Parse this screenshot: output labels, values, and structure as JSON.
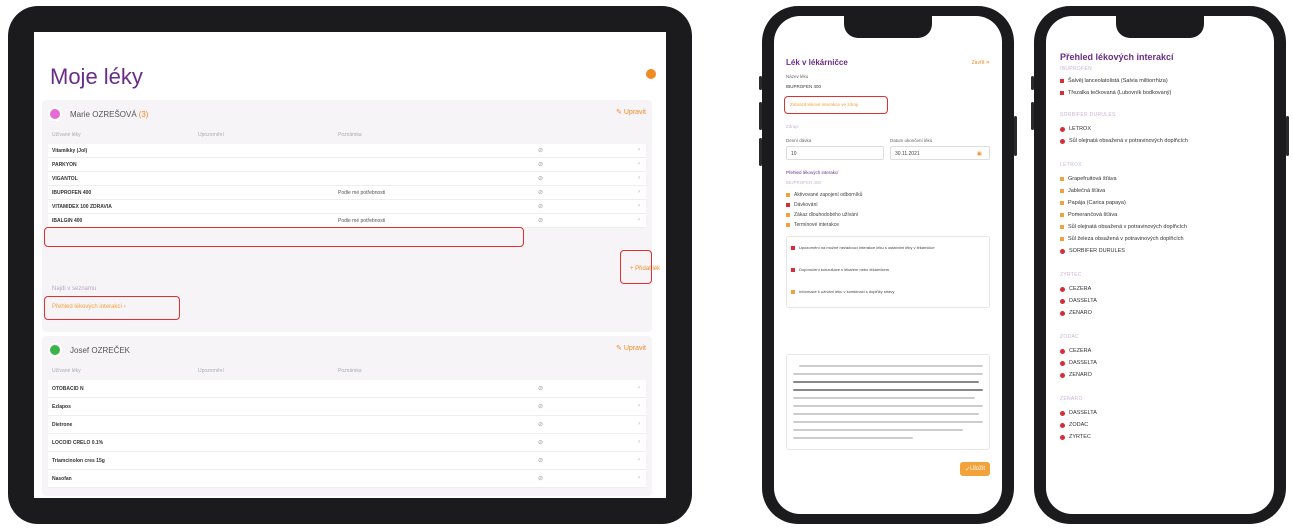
{
  "colors": {
    "purple": "#6a2d86",
    "orange": "#f08a24",
    "red": "#e03030",
    "yellow": "#f2a23a",
    "red_marker": "#d62d3a"
  },
  "tablet": {
    "title": "Moje léky",
    "patient1": {
      "name": "Marie OZREŠOVÁ",
      "tag": "(3)",
      "edit": "Upravit",
      "col_headers": [
        "Užívané léky",
        "Upozornění",
        "Poznámka"
      ],
      "drugs": [
        {
          "name": "Vitamikky (Jol)",
          "note": ""
        },
        {
          "name": "PARKYON",
          "note": ""
        },
        {
          "name": "VIGANTOL",
          "note": ""
        },
        {
          "name": "IBUPROFEN 400",
          "note": "Podle mé potřebnosti"
        },
        {
          "name": "VITAMIDEX 100 ZDRAVIA",
          "note": ""
        },
        {
          "name": "IBALGIN 400",
          "note": "Podle mé potřebnosti"
        }
      ],
      "add": "Přidat lék",
      "link1": "Najdi v seznamu",
      "link2": "Přehled lékových interakcí ›"
    },
    "patient2": {
      "name": "Josef OZREČEK",
      "edit": "Upravit",
      "col_headers": [
        "Užívané léky",
        "Upozornění",
        "Poznámka"
      ],
      "drugs": [
        {
          "name": "OTOBACID N"
        },
        {
          "name": "Ezlapos"
        },
        {
          "name": "Dietrone"
        },
        {
          "name": "LOCOID CRELO 0.1%"
        },
        {
          "name": "Triamcinolon cres 15g"
        },
        {
          "name": "Nasofan"
        }
      ]
    }
  },
  "phone1": {
    "title": "Lék v lékárničce",
    "close": "Zavřít",
    "drug_label": "Název léku",
    "drug_value": "IBUPROFEN 400",
    "interaction_link": "Zobrazit lékové interakce ve zdroji",
    "section": "Zdroje",
    "dose_label": "Denní dávka",
    "date_label": "Datum ukončení léku",
    "dose_value": "10",
    "date_value": "30.11.2021",
    "overview": "Přehled lékových interakcí",
    "sub": "IBUPROFEN 400",
    "items": [
      "Aktivované zapojení odborníků",
      "Dávkování",
      "Zákaz dlouhodobého užívání",
      "Termínové interakce"
    ],
    "warning_lines": [
      "Upozornění na možné nežádoucí interakce léku s ostatními léky v lékárničce",
      "Doporučení konzultace s lékařem nebo lékárníkem",
      "Informace k užívání léku v kombinaci s doplňky stravy"
    ],
    "save": "Uložit"
  },
  "phone2": {
    "title": "Přehled lékových interakcí",
    "groups": [
      {
        "label": "IBUPROFEN",
        "items": [
          {
            "t": "Šalvěj lanceolatolistá (Salvia miltiorrhiza)",
            "c": "red-sq"
          },
          {
            "t": "Třezalka tečkovaná (Lubovník bodkovaný)",
            "c": "red-sq"
          }
        ]
      },
      {
        "label": "SORBIFER DURULES",
        "items": [
          {
            "t": "LETROX",
            "c": "red-dot"
          },
          {
            "t": "Sůl olejnatá obsažená v potravinových doplňcích",
            "c": "red-dot"
          }
        ]
      },
      {
        "label": "LETROX",
        "items": [
          {
            "t": "Grapefruitová šťáva",
            "c": "y-sq"
          },
          {
            "t": "Jablečná šťáva",
            "c": "y-sq"
          },
          {
            "t": "Papája (Carica papaya)",
            "c": "y-sq"
          },
          {
            "t": "Pomerančová šťáva",
            "c": "y-sq"
          },
          {
            "t": "Sůl olejnatá obsažená v potravinových doplňcích",
            "c": "y-sq"
          },
          {
            "t": "Sůl železa obsažená v potravinových doplňcích",
            "c": "y-sq"
          },
          {
            "t": "SORBIFER DURULES",
            "c": "red-dot"
          }
        ]
      },
      {
        "label": "ZYRTEC",
        "items": [
          {
            "t": "CEZERA",
            "c": "red-dot"
          },
          {
            "t": "DASSELTA",
            "c": "red-dot"
          },
          {
            "t": "ZENARO",
            "c": "red-dot"
          }
        ]
      },
      {
        "label": "ZODAC",
        "items": [
          {
            "t": "CEZERA",
            "c": "red-dot"
          },
          {
            "t": "DASSELTA",
            "c": "red-dot"
          },
          {
            "t": "ZENARO",
            "c": "red-dot"
          }
        ]
      },
      {
        "label": "ZENARO",
        "items": [
          {
            "t": "DASSELTA",
            "c": "red-dot"
          },
          {
            "t": "ZODAC",
            "c": "red-dot"
          },
          {
            "t": "ZYRTEC",
            "c": "red-dot"
          }
        ]
      }
    ]
  }
}
